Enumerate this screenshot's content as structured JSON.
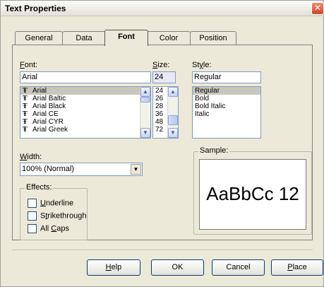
{
  "window": {
    "title": "Text Properties",
    "close_glyph": "✕"
  },
  "tabs": [
    {
      "label": "General"
    },
    {
      "label": "Data"
    },
    {
      "label": "Font",
      "active": true
    },
    {
      "label": "Color"
    },
    {
      "label": "Position"
    }
  ],
  "font": {
    "label_hot": "F",
    "label_rest": "ont:",
    "value": "Arial",
    "list": [
      "Arial",
      "Arial Baltic",
      "Arial Black",
      "Arial CE",
      "Arial CYR",
      "Arial Greek"
    ],
    "selected": "Arial",
    "truetype_glyph": "Ŧ"
  },
  "size": {
    "label_hot": "S",
    "label_rest": "ize:",
    "value": "24",
    "list": [
      "24",
      "26",
      "28",
      "36",
      "48",
      "72"
    ]
  },
  "style": {
    "label_pre": "St",
    "label_hot": "y",
    "label_rest": "le:",
    "value": "Regular",
    "list": [
      "Regular",
      "Bold",
      "Bold Italic",
      "Italic"
    ],
    "selected": "Regular"
  },
  "width": {
    "label_hot": "W",
    "label_rest": "idth:",
    "value": "100% (Normal)"
  },
  "effects": {
    "title": "Effects:",
    "items": [
      {
        "hot": "U",
        "rest": "nderline",
        "pre": ""
      },
      {
        "pre": "S",
        "hot": "t",
        "rest": "rikethrough"
      },
      {
        "pre": "All ",
        "hot": "C",
        "rest": "aps"
      }
    ]
  },
  "sample": {
    "title": "Sample:",
    "text": "AaBbCc 12"
  },
  "buttons": {
    "help_hot": "H",
    "help_rest": "elp",
    "ok": "OK",
    "cancel": "Cancel",
    "place_hot": "P",
    "place_rest": "lace"
  },
  "glyphs": {
    "up": "▲",
    "down": "▼"
  }
}
